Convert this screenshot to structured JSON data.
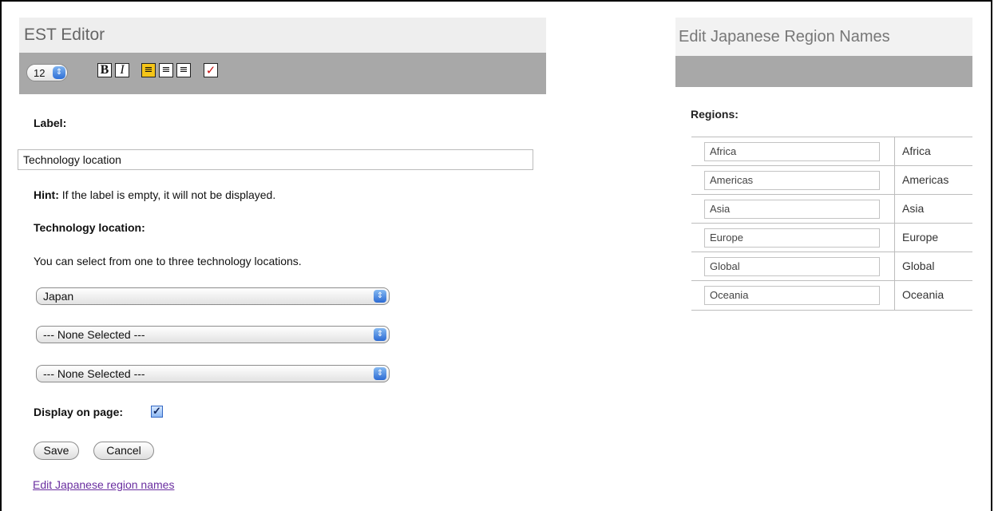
{
  "editor": {
    "title": "EST Editor",
    "font_size": "12",
    "bold_label": "B",
    "italic_label": "I"
  },
  "form": {
    "label_heading": "Label:",
    "label_value": "Technology location",
    "hint_bold": "Hint:",
    "hint_text": " If the label is empty, it will not be displayed.",
    "tech_heading": "Technology location:",
    "tech_desc": "You can select from one to three technology locations.",
    "locations": [
      "Japan",
      "--- None Selected ---",
      "--- None Selected ---"
    ],
    "display_label": "Display on page:",
    "display_checked": true,
    "save_label": "Save",
    "cancel_label": "Cancel",
    "edit_link": "Edit Japanese region names"
  },
  "regions_panel": {
    "title": "Edit Japanese Region Names",
    "heading": "Regions:",
    "rows": [
      {
        "input": "Africa",
        "name": "Africa"
      },
      {
        "input": "Americas",
        "name": "Americas"
      },
      {
        "input": "Asia",
        "name": "Asia"
      },
      {
        "input": "Europe",
        "name": "Europe"
      },
      {
        "input": "Global",
        "name": "Global"
      },
      {
        "input": "Oceania",
        "name": "Oceania"
      }
    ]
  },
  "icons": {
    "select_arrows": "updown-arrows-icon",
    "align_left": "align-left-icon",
    "align_center": "align-center-icon",
    "align_right": "align-right-icon",
    "spellcheck": "checkmark-icon"
  },
  "colors": {
    "toolbar": "#a8a8a8",
    "title_bg": "#eeeeee",
    "link": "#6a2fa0",
    "active_align": "#f5c518"
  }
}
